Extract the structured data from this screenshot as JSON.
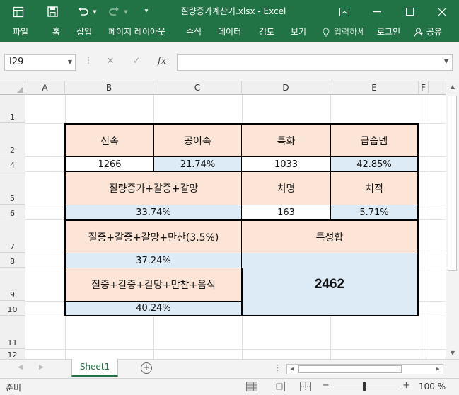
{
  "window": {
    "title": "질량증가계산기.xlsx - Excel",
    "icons": {
      "save": "save-icon",
      "undo": "undo-icon",
      "redo": "redo-icon",
      "ribbon_display": "ribbon-display-icon",
      "minimize": "minimize-icon",
      "maximize": "maximize-icon",
      "close": "close-icon"
    }
  },
  "ribbon": {
    "tabs": [
      "파일",
      "홈",
      "삽입",
      "페이지 레이아웃",
      "수식",
      "데이터",
      "검토",
      "보기"
    ],
    "tell_me": "입력하세",
    "login": "로그인",
    "share": "공유"
  },
  "formula_bar": {
    "name_box": "I29",
    "fx": "fx",
    "value": ""
  },
  "columns": [
    "A",
    "B",
    "C",
    "D",
    "E",
    "F"
  ],
  "rows": [
    "1",
    "2",
    "4",
    "5",
    "6",
    "7",
    "8",
    "9",
    "10",
    "11",
    "12"
  ],
  "cells": {
    "B2": "신속",
    "C2": "공이속",
    "D2": "특화",
    "E2": "급습뎀",
    "B4": "1266",
    "C4": "21.74%",
    "D4": "1033",
    "E4": "42.85%",
    "B5": "질량증가+갈증+갈망",
    "D5": "치명",
    "E5": "치적",
    "B6": "33.74%",
    "D6": "163",
    "E6": "5.71%",
    "B7": "질증+갈증+갈망+만찬(3.5%)",
    "D7": "특성합",
    "B8": "37.24%",
    "B9": "질증+갈증+갈망+만찬+음식",
    "D8": "2462",
    "B10": "40.24%"
  },
  "colors": {
    "header_fill": "#fce4d6",
    "value_fill": "#ddebf7",
    "excel_green": "#217346"
  },
  "sheets": [
    "Sheet1"
  ],
  "status": {
    "ready": "준비",
    "zoom": "100 %"
  }
}
